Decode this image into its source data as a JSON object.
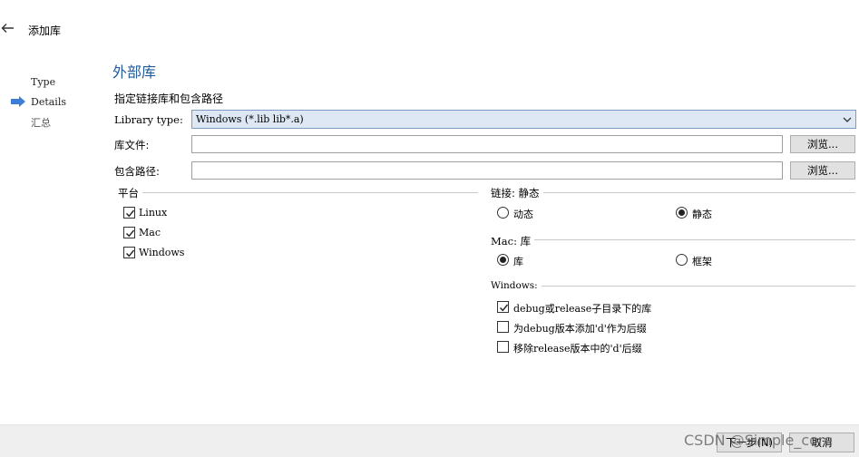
{
  "header": {
    "title": "添加库"
  },
  "steps": [
    {
      "label": "Type",
      "active": false
    },
    {
      "label": "Details",
      "active": true
    },
    {
      "label": "汇总",
      "active": false
    }
  ],
  "section": {
    "title": "外部库",
    "subtitle": "指定链接库和包含路径"
  },
  "library_type": {
    "label": "Library type:",
    "value": "Windows (*.lib lib*.a)"
  },
  "library_file": {
    "label": "库文件:",
    "value": "",
    "browse_label": "浏览..."
  },
  "include_path": {
    "label": "包含路径:",
    "value": "",
    "browse_label": "浏览..."
  },
  "platform": {
    "title": "平台",
    "options": [
      {
        "label": "Linux",
        "checked": true
      },
      {
        "label": "Mac",
        "checked": true
      },
      {
        "label": "Windows",
        "checked": true
      }
    ]
  },
  "linkage": {
    "title": "链接: 静态",
    "options": [
      {
        "label": "动态",
        "selected": false
      },
      {
        "label": "静态",
        "selected": true
      }
    ]
  },
  "mac": {
    "title": "Mac: 库",
    "options": [
      {
        "label": "库",
        "selected": true
      },
      {
        "label": "框架",
        "selected": false
      }
    ]
  },
  "windows": {
    "title": "Windows:",
    "options": [
      {
        "label": "debug或release子目录下的库",
        "checked": true
      },
      {
        "label": "为debug版本添加'd'作为后缀",
        "checked": false
      },
      {
        "label": "移除release版本中的'd'后缀",
        "checked": false
      }
    ]
  },
  "footer": {
    "next_label": "下一步(N)",
    "cancel_label": "取消"
  },
  "watermark": "CSDN @Simple_core",
  "colors": {
    "accent": "#1e5a9c",
    "combo_bg": "#dde8f4",
    "step_arrow": "#3d7fd6"
  },
  "icons": {
    "back": "arrow-left-icon",
    "step": "arrow-right-icon",
    "combo": "chevron-down-icon"
  }
}
